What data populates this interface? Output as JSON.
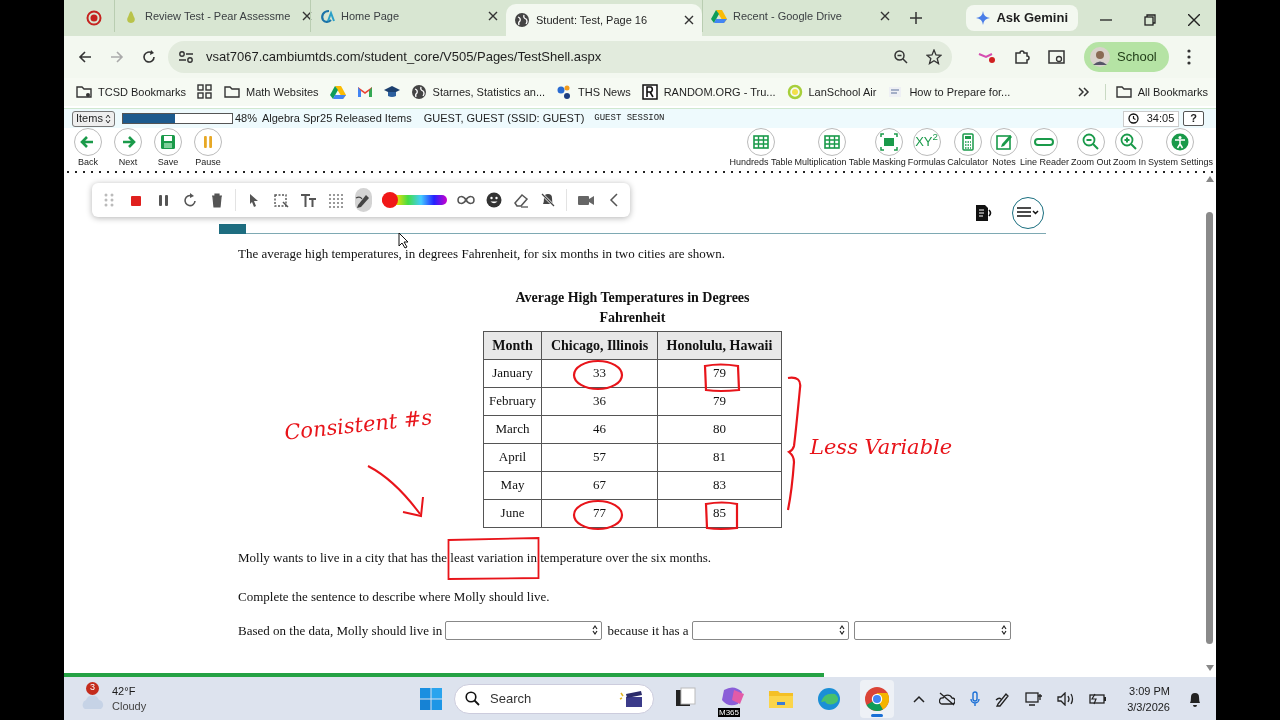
{
  "browser": {
    "tabs": [
      {
        "kind": "record",
        "selected": false
      },
      {
        "kind": "pear",
        "title": "Review Test - Pear Assessme",
        "selected": false
      },
      {
        "kind": "ca",
        "title": "Home Page",
        "selected": false
      },
      {
        "kind": "globe",
        "title": "Student: Test, Page 16",
        "selected": true
      },
      {
        "kind": "drive",
        "title": "Recent - Google Drive",
        "selected": false
      }
    ],
    "gemini": "Ask Gemini",
    "url": "vsat7067.cambiumtds.com/student_core/V505/Pages/TestShell.aspx",
    "profile": "School",
    "bookmarks": [
      {
        "kind": "folder-gear",
        "label": "TCSD Bookmarks"
      },
      {
        "kind": "apps"
      },
      {
        "kind": "folder",
        "label": "Math Websites"
      },
      {
        "kind": "drive"
      },
      {
        "kind": "mail"
      },
      {
        "kind": "cap"
      },
      {
        "kind": "globe",
        "label": "Starnes, Statistics an..."
      },
      {
        "kind": "dots",
        "label": "THS News"
      },
      {
        "kind": "square",
        "label": "RANDOM.ORG - Tru..."
      },
      {
        "kind": "ring",
        "label": "LanSchool Air"
      },
      {
        "kind": "site",
        "label": "How to Prepare for..."
      }
    ],
    "all_bookmarks": "All Bookmarks"
  },
  "test": {
    "items": "Items",
    "progress": {
      "level": 0.48,
      "text": "48%"
    },
    "name": "Algebra Spr25 Released Items",
    "user": "GUEST, GUEST (SSID: GUEST)",
    "session": "GUEST SESSION",
    "timer": "34:05",
    "help": "?",
    "nav": [
      {
        "kind": "back",
        "label": "Back"
      },
      {
        "kind": "next",
        "label": "Next"
      },
      {
        "kind": "save",
        "label": "Save"
      },
      {
        "kind": "pause",
        "label": "Pause"
      }
    ],
    "tools": [
      {
        "kind": "table",
        "label": "Hundreds Table"
      },
      {
        "kind": "table",
        "label": "Multiplication Table"
      },
      {
        "kind": "mask",
        "label": "Masking"
      },
      {
        "kind": "formula",
        "label": "Formulas",
        "icon_text": "XY$^{2}$"
      },
      {
        "kind": "calc",
        "label": "Calculator"
      },
      {
        "kind": "notes",
        "label": "Notes"
      },
      {
        "kind": "reader",
        "label": "Line Reader"
      },
      {
        "kind": "zoomout",
        "label": "Zoom Out"
      },
      {
        "kind": "zoomin",
        "label": "Zoom In"
      },
      {
        "kind": "access",
        "label": "System Settings"
      }
    ]
  },
  "annotation_toolbar": {
    "tools": [
      {
        "kind": "handle",
        "selected": false
      },
      {
        "kind": "stop",
        "selected": false
      },
      {
        "kind": "pause",
        "selected": false
      },
      {
        "kind": "redo",
        "selected": false
      },
      {
        "kind": "trash",
        "selected": false
      },
      {
        "kind": "pointer",
        "selected": false
      },
      {
        "kind": "select",
        "selected": false
      },
      {
        "kind": "text",
        "selected": false
      },
      {
        "kind": "grid",
        "selected": false
      },
      {
        "kind": "pen",
        "selected": true
      },
      {
        "kind": "colors",
        "selected": false
      },
      {
        "kind": "link",
        "selected": false
      },
      {
        "kind": "emoji",
        "selected": false
      },
      {
        "kind": "eraser",
        "selected": false
      },
      {
        "kind": "bell-off",
        "selected": false
      },
      {
        "kind": "camera",
        "selected": false
      },
      {
        "kind": "collapse",
        "selected": false
      }
    ]
  },
  "question": {
    "intro": "The average high temperatures, in degrees Fahrenheit, for six months in two cities are shown.",
    "table": {
      "title": "Average High Temperatures in Degrees Fahrenheit",
      "columns": [
        "Month",
        "Chicago, Illinois",
        "Honolulu, Hawaii"
      ],
      "rows": [
        [
          "January",
          "33",
          "79"
        ],
        [
          "February",
          "36",
          "79"
        ],
        [
          "March",
          "46",
          "80"
        ],
        [
          "April",
          "57",
          "81"
        ],
        [
          "May",
          "67",
          "83"
        ],
        [
          "June",
          "77",
          "85"
        ]
      ]
    },
    "statement": "Molly wants to live in a city that has the least variation in temperature over the six months.",
    "prompt": "Complete the sentence to describe where Molly should live.",
    "sentence": [
      {
        "kind": "text",
        "text": "Based on the data, Molly should live in"
      },
      {
        "kind": "select"
      },
      {
        "kind": "text",
        "text": "because it has a"
      },
      {
        "kind": "select"
      },
      {
        "kind": "select"
      }
    ]
  },
  "ink": {
    "notes": [
      "Consistent #s",
      "Less Variable"
    ]
  },
  "page_progress": {
    "level": 0.66
  },
  "taskbar": {
    "weather": {
      "badge": "3",
      "temp": "42°F",
      "condition": "Cloudy"
    },
    "search": "Search",
    "apps": [
      {
        "kind": "taskview",
        "selected": false
      },
      {
        "kind": "copilot",
        "badge": "M365",
        "selected": false
      },
      {
        "kind": "explorer",
        "selected": false
      },
      {
        "kind": "edge",
        "selected": false
      },
      {
        "kind": "chrome",
        "selected": true
      }
    ],
    "time": "3:09 PM",
    "date": "3/3/2026"
  }
}
